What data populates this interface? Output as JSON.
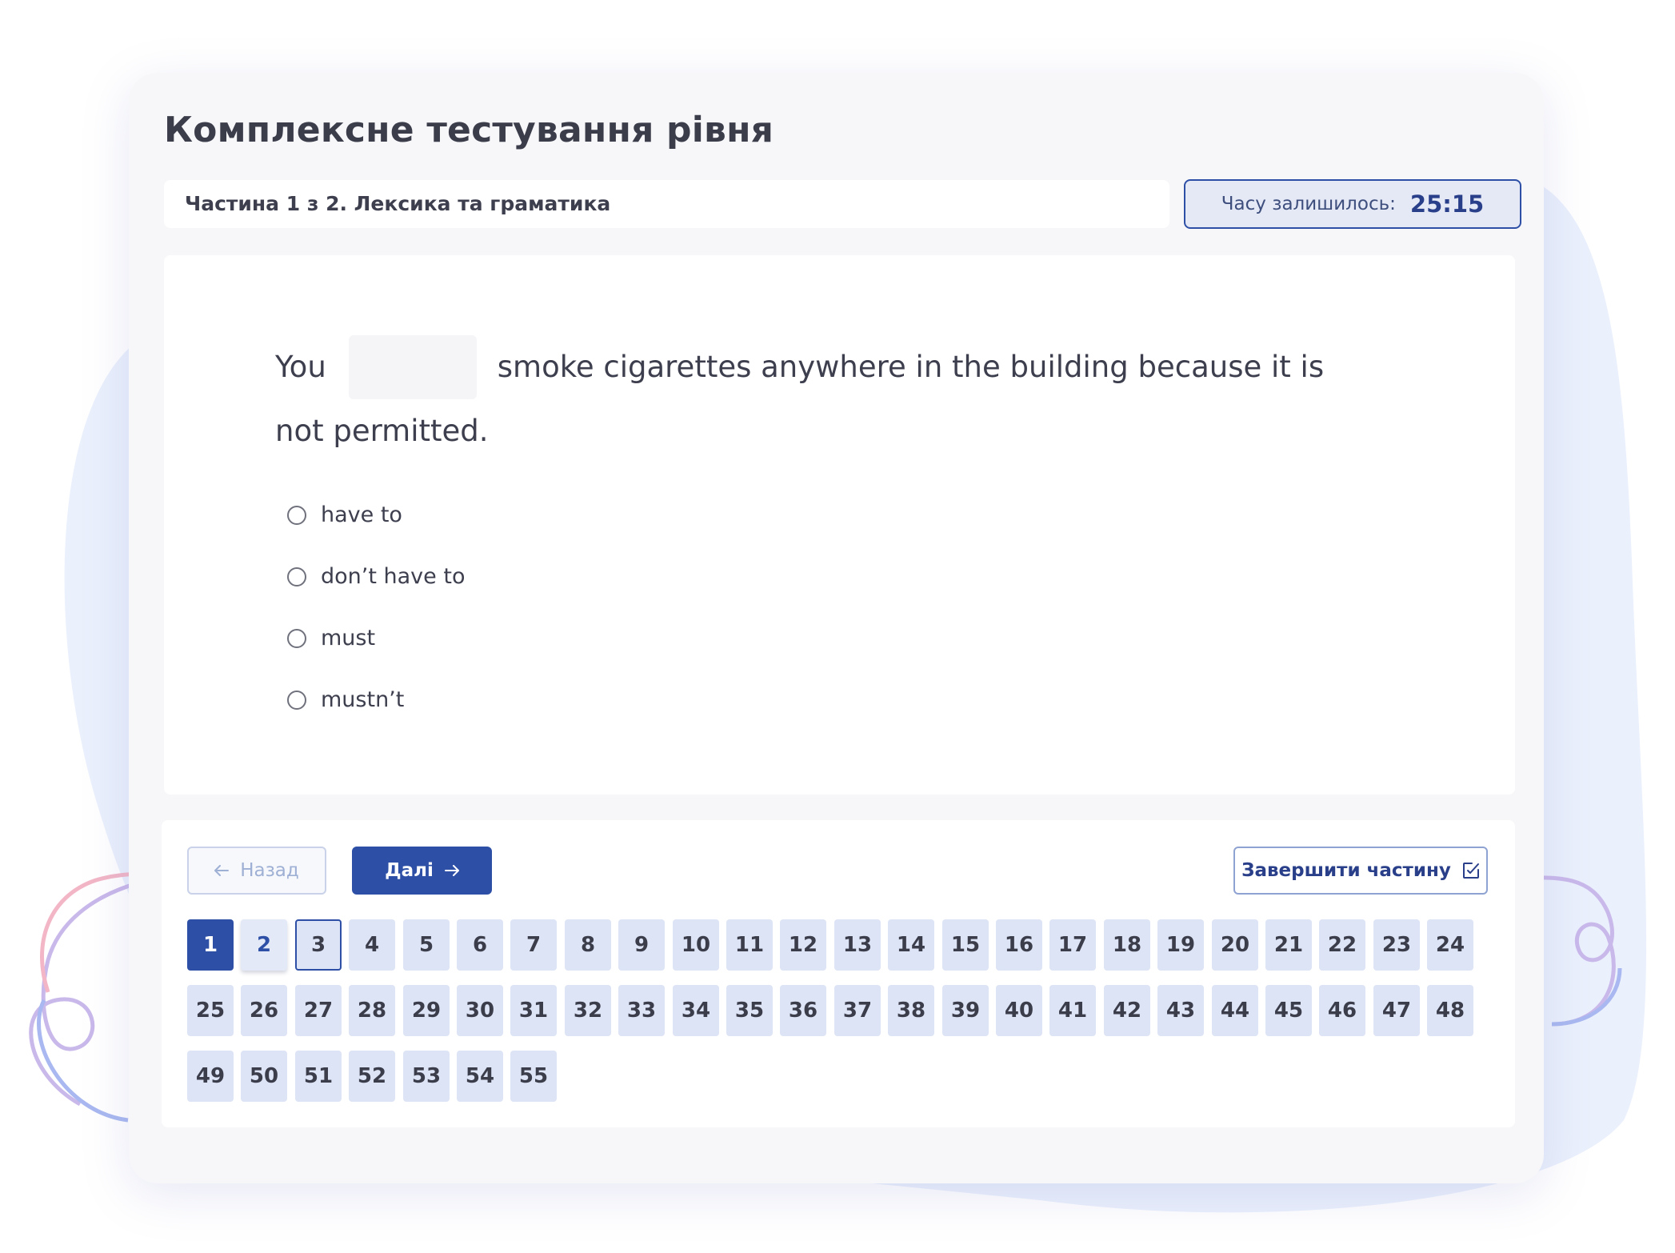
{
  "colors": {
    "accent": "#2d4fa6",
    "cell_bg": "#dde4f6",
    "panel_bg": "#ffffff",
    "card_bg": "#f7f7f9"
  },
  "page": {
    "title": "Комплексне тестування рівня"
  },
  "part": {
    "label": "Частина 1 з 2. Лексика та граматика"
  },
  "timer": {
    "label": "Часу залишилось:",
    "value": "25:15"
  },
  "question": {
    "before_blank": "You",
    "after_blank": "smoke cigarettes anywhere in the building because it is",
    "line2": "not permitted.",
    "options": [
      "have to",
      "don’t have to",
      "must",
      "mustn’t"
    ]
  },
  "nav": {
    "back_label": "Назад",
    "next_label": "Далі",
    "finish_label": "Завершити частину",
    "back_icon": "arrow-left-icon",
    "next_icon": "arrow-right-icon",
    "finish_icon": "checkbox-edit-icon",
    "current_question": 1,
    "visited": [
      2
    ],
    "outlined": [
      3
    ],
    "questions": [
      "1",
      "2",
      "3",
      "4",
      "5",
      "6",
      "7",
      "8",
      "9",
      "10",
      "11",
      "12",
      "13",
      "14",
      "15",
      "16",
      "17",
      "18",
      "19",
      "20",
      "21",
      "22",
      "23",
      "24",
      "25",
      "26",
      "27",
      "28",
      "29",
      "30",
      "31",
      "32",
      "33",
      "34",
      "35",
      "36",
      "37",
      "38",
      "39",
      "40",
      "41",
      "42",
      "43",
      "44",
      "45",
      "46",
      "47",
      "48",
      "49",
      "50",
      "51",
      "52",
      "53",
      "54",
      "55"
    ]
  }
}
